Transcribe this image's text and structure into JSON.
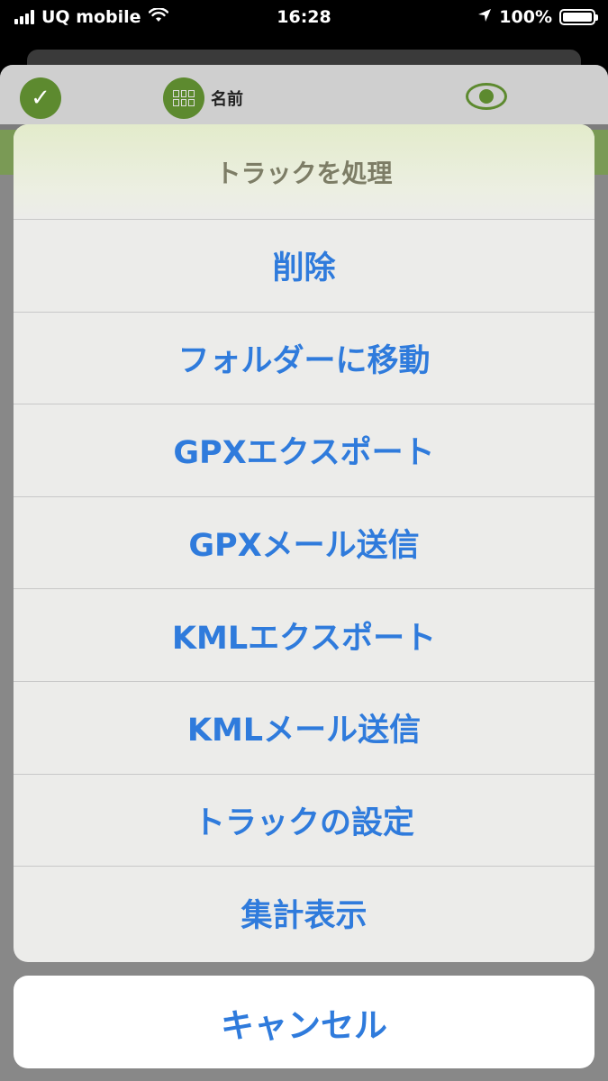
{
  "status_bar": {
    "carrier": "UQ mobile",
    "time": "16:28",
    "battery": "100%"
  },
  "app": {
    "sort_label": "名前"
  },
  "action_sheet": {
    "title": "トラックを処理",
    "items": [
      "削除",
      "フォルダーに移動",
      "GPXエクスポート",
      "GPXメール送信",
      "KMLエクスポート",
      "KMLメール送信",
      "トラックの設定",
      "集計表示"
    ],
    "cancel": "キャンセル"
  },
  "colors": {
    "action_blue": "#2f7bdc",
    "title_gray": "#7d7d66",
    "app_green": "#5d8a2f"
  }
}
